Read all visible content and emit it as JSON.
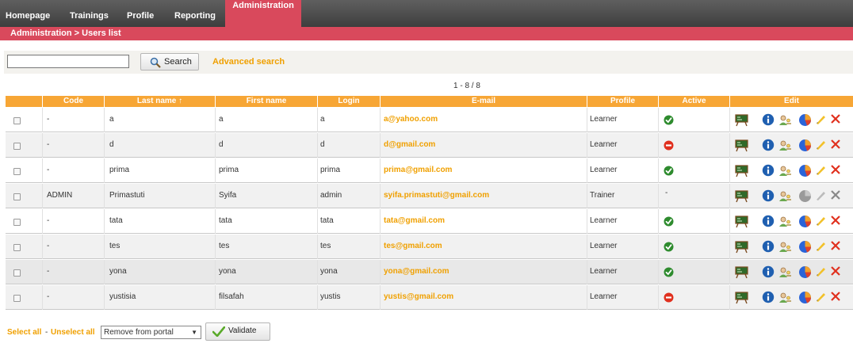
{
  "nav": {
    "tabs": [
      "Homepage",
      "Trainings",
      "Profile",
      "Reporting"
    ],
    "active_tab": "Administration"
  },
  "breadcrumb": "Administration > Users list",
  "search": {
    "value": "",
    "button_label": "Search",
    "advanced_label": "Advanced search"
  },
  "pager": "1 - 8 / 8",
  "table": {
    "columns": [
      "Code",
      "Last name ↑",
      "First name",
      "Login",
      "E-mail",
      "Profile",
      "Active",
      "Edit"
    ],
    "rows": [
      {
        "code": "-",
        "last": "a",
        "first": "a",
        "login": "a",
        "email": "a@yahoo.com",
        "profile": "Learner",
        "active": "active"
      },
      {
        "code": "-",
        "last": "d",
        "first": "d",
        "login": "d",
        "email": "d@gmail.com",
        "profile": "Learner",
        "active": "inactive"
      },
      {
        "code": "-",
        "last": "prima",
        "first": "prima",
        "login": "prima",
        "email": "prima@gmail.com",
        "profile": "Learner",
        "active": "active"
      },
      {
        "code": "ADMIN",
        "last": "Primastuti",
        "first": "Syifa",
        "login": "admin",
        "email": "syifa.primastuti@gmail.com",
        "profile": "Trainer",
        "active": "-"
      },
      {
        "code": "-",
        "last": "tata",
        "first": "tata",
        "login": "tata",
        "email": "tata@gmail.com",
        "profile": "Learner",
        "active": "active"
      },
      {
        "code": "-",
        "last": "tes",
        "first": "tes",
        "login": "tes",
        "email": "tes@gmail.com",
        "profile": "Learner",
        "active": "active"
      },
      {
        "code": "-",
        "last": "yona",
        "first": "yona",
        "login": "yona",
        "email": "yona@gmail.com",
        "profile": "Learner",
        "active": "active"
      },
      {
        "code": "-",
        "last": "yustisia",
        "first": "filsafah",
        "login": "yustis",
        "email": "yustis@gmail.com",
        "profile": "Learner",
        "active": "inactive"
      }
    ],
    "edit_icons": [
      "user-courses-icon",
      "info-icon",
      "user-roles-icon",
      "reporting-pie-icon",
      "edit-pencil-icon",
      "delete-x-icon"
    ]
  },
  "footer": {
    "select_all": "Select all",
    "separator": "-",
    "unselect_all": "Unselect all",
    "action_selected": "Remove from portal",
    "validate_label": "Validate"
  },
  "colors": {
    "nav_bg": "#4a4a4a",
    "accent_red": "#d9495c",
    "header_orange": "#f7a635",
    "link_orange": "#f0a000",
    "active_green": "#2e8b2e",
    "inactive_red": "#e0301e"
  }
}
